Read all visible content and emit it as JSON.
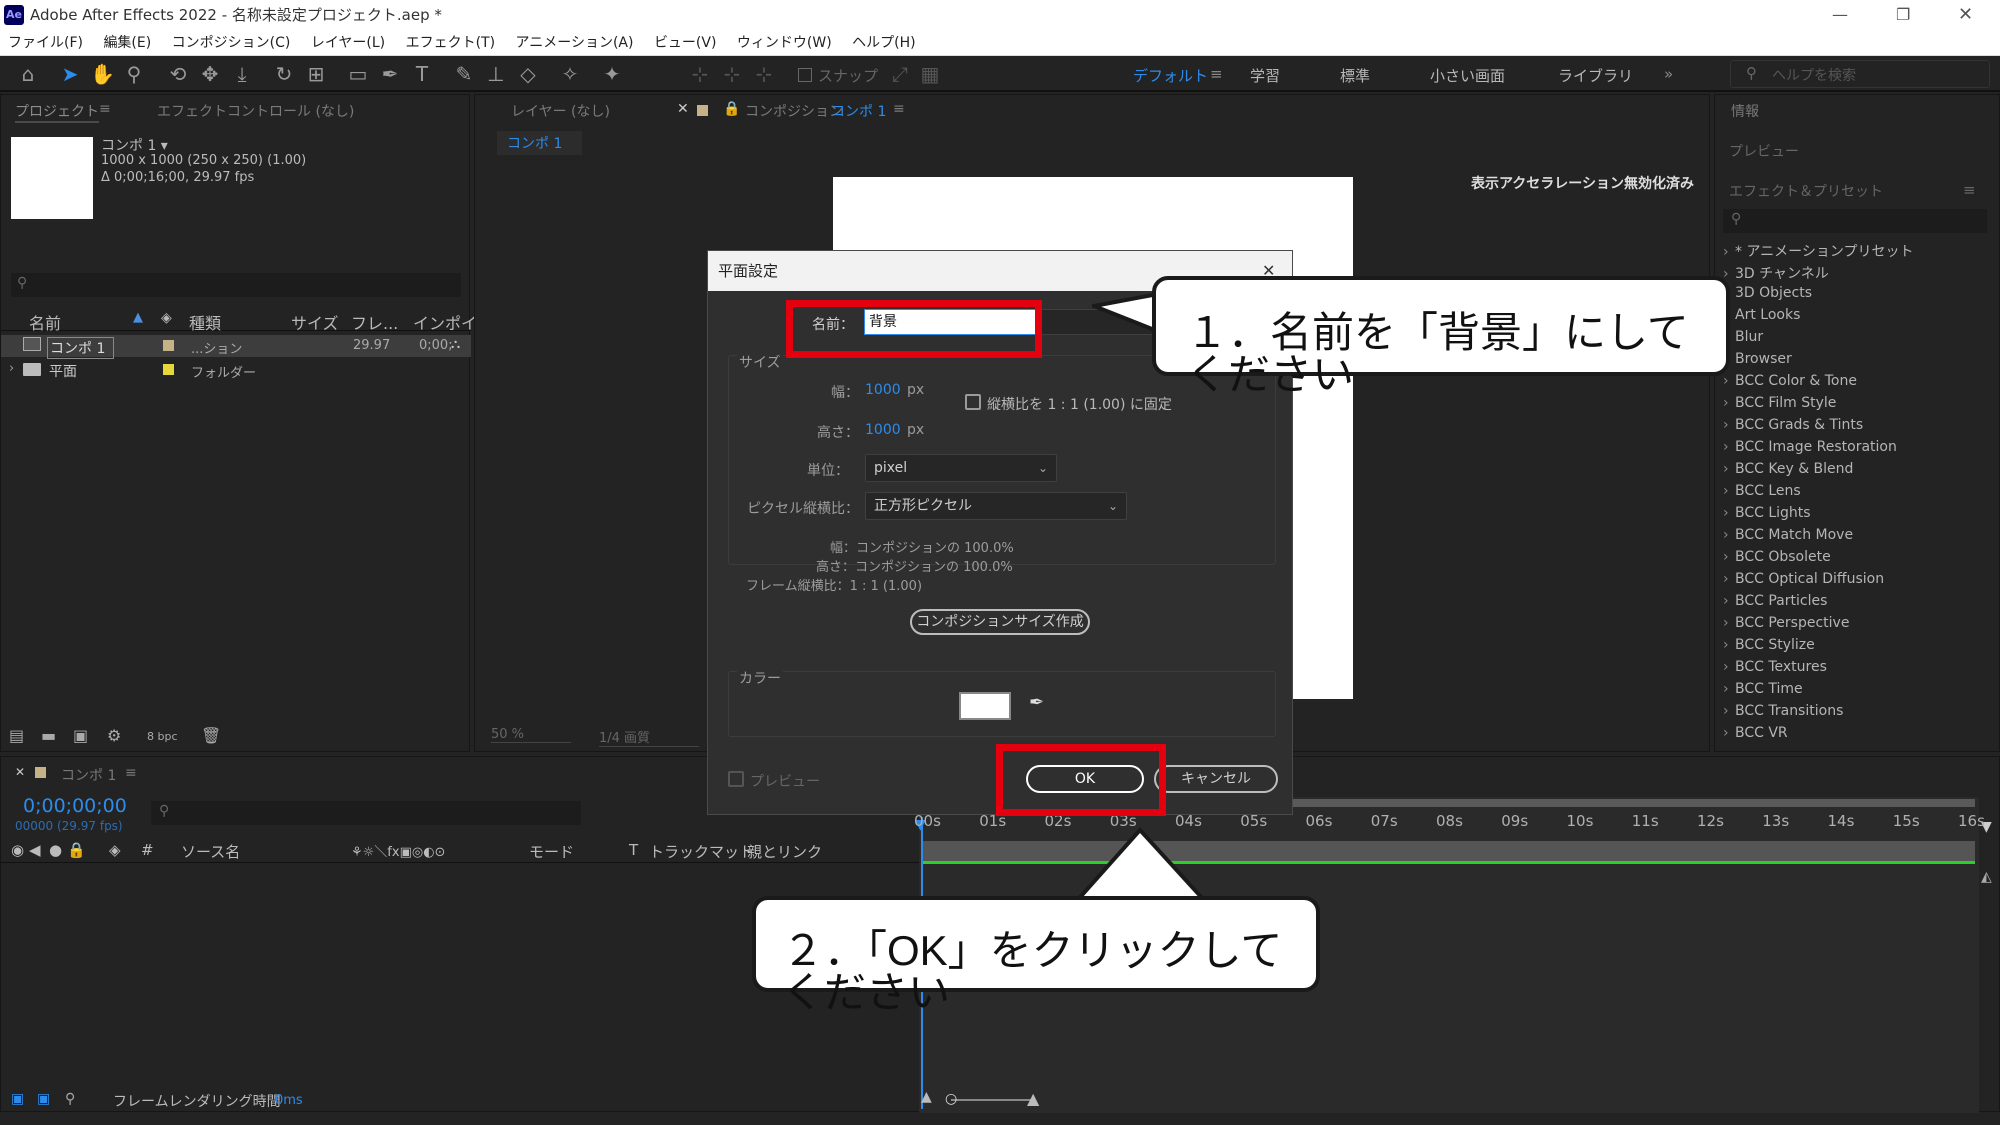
{
  "app": {
    "title": "Adobe After Effects 2022 - 名称未設定プロジェクト.aep *",
    "logo": "Ae"
  },
  "menu": [
    "ファイル(F)",
    "編集(E)",
    "コンポジション(C)",
    "レイヤー(L)",
    "エフェクト(T)",
    "アニメーション(A)",
    "ビュー(V)",
    "ウィンドウ(W)",
    "ヘルプ(H)"
  ],
  "toolbar": {
    "snap_label": "スナップ"
  },
  "workspaces": {
    "items": [
      "デフォルト",
      "学習",
      "標準",
      "小さい画面",
      "ライブラリ"
    ],
    "search_placeholder": "ヘルプを検索"
  },
  "project_panel": {
    "tab_project": "プロジェクト",
    "tab_effects": "エフェクトコントロール (なし)",
    "comp_name": "コンポ 1 ▾",
    "comp_info1": "1000 x 1000  (250 x 250) (1.00)",
    "comp_info2": "Δ 0;00;16;00, 29.97 fps",
    "columns": [
      "名前",
      "種類",
      "サイズ",
      "フレ...",
      "インポイ"
    ],
    "rows": [
      {
        "name": "コンポ 1",
        "type": "...ション",
        "fps": "29.97",
        "inpoint": "0;00;"
      },
      {
        "name": "平面",
        "type": "フォルダー",
        "fps": "",
        "inpoint": ""
      }
    ],
    "bpc": "8 bpc"
  },
  "comp_viewer": {
    "tab_layer": "レイヤー (なし)",
    "tab_comp_prefix": "コンポジション",
    "tab_comp_name": "コンポ 1",
    "breadcrumb": "コンポ 1",
    "accel_note": "表示アクセラレーション無効化済み",
    "zoom": "50 %",
    "resolution": "1/4 画質"
  },
  "right_panel": {
    "info": "情報",
    "preview": "プレビュー",
    "effects_presets": "エフェクト＆プリセット",
    "effects": [
      "* アニメーションプリセット",
      "3D チャンネル",
      "3D Objects",
      "Art Looks",
      "Blur",
      "Browser",
      "BCC Color & Tone",
      "BCC Film Style",
      "BCC Grads & Tints",
      "BCC Image Restoration",
      "BCC Key & Blend",
      "BCC Lens",
      "BCC Lights",
      "BCC Match Move",
      "BCC Obsolete",
      "BCC Optical Diffusion",
      "BCC Particles",
      "BCC Perspective",
      "BCC Stylize",
      "BCC Textures",
      "BCC Time",
      "BCC Transitions",
      "BCC VR"
    ]
  },
  "timeline": {
    "tab": "コンポ 1",
    "timecode": "0;00;00;00",
    "timecode_sub": "00000 (29.97 fps)",
    "col_source": "ソース名",
    "col_mode": "モード",
    "col_trackmatte": "トラックマット",
    "col_parent": "親とリンク",
    "ticks": [
      "00s",
      "01s",
      "02s",
      "03s",
      "04s",
      "05s",
      "06s",
      "07s",
      "08s",
      "09s",
      "10s",
      "11s",
      "12s",
      "13s",
      "14s",
      "15s",
      "16s"
    ],
    "footer_label": "フレームレンダリング時間",
    "footer_value": "0ms"
  },
  "dialog": {
    "title": "平面設定",
    "name_label": "名前：",
    "name_value": "背景",
    "size_group": "サイズ",
    "width_label": "幅：",
    "width_value": "1000",
    "height_label": "高さ：",
    "height_value": "1000",
    "px": "px",
    "lock_aspect": "縦横比を 1 : 1 (1.00) に固定",
    "unit_label": "単位：",
    "unit_value": "pixel",
    "pixel_aspect_label": "ピクセル縦横比：",
    "pixel_aspect_value": "正方形ピクセル",
    "info_width": "幅：コンポジションの 100.0%",
    "info_height": "高さ：コンポジションの 100.0%",
    "info_frame": "フレーム縦横比：1 : 1 (1.00)",
    "make_comp_size": "コンポジションサイズ作成",
    "color_group": "カラー",
    "color_value": "#ffffff",
    "preview_label": "プレビュー",
    "ok": "OK",
    "cancel": "キャンセル"
  },
  "annotations": {
    "step1": "１．名前を「背景」にしてください",
    "step2": "２．「OK」をクリックしてください",
    "highlight_color": "#e4000f"
  }
}
